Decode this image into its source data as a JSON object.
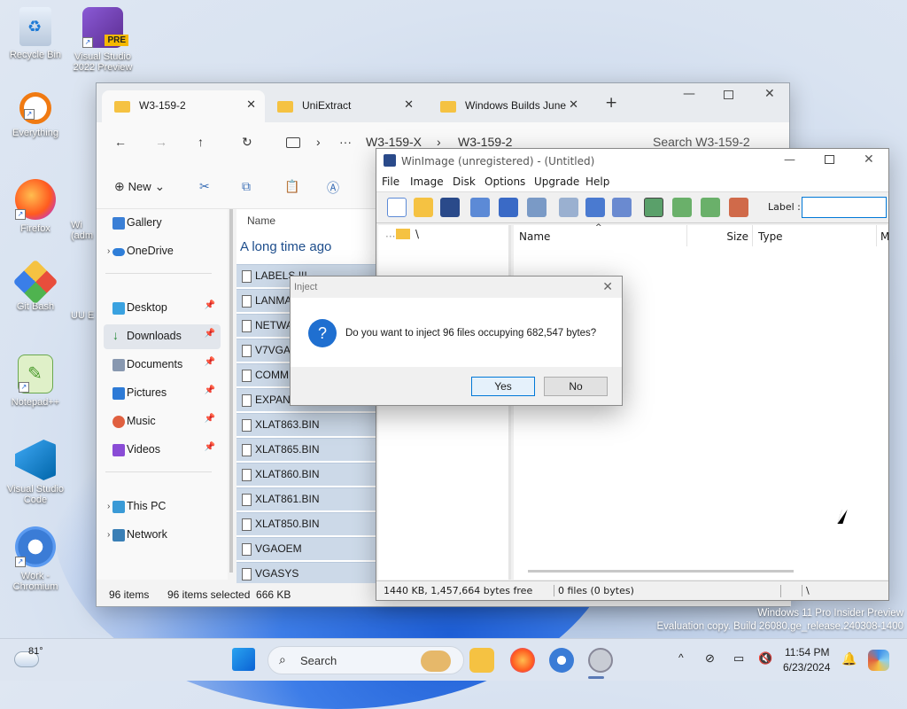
{
  "desktop": {
    "icons": [
      "Recycle Bin",
      "Visual Studio 2022 Preview",
      "Everything",
      "Firefox",
      "Git Bash",
      "Notepad++",
      "Visual Studio Code",
      "Work - Chromium"
    ],
    "partial_labels": [
      "Wi",
      "Wi (adm",
      "UU E"
    ],
    "pre_badge": "PRE"
  },
  "explorer": {
    "tabs": [
      "W3-159-2",
      "UniExtract",
      "Windows Builds June"
    ],
    "new_tab": "+",
    "breadcrumb": [
      "W3-159-X",
      "W3-159-2"
    ],
    "more": "···",
    "search_placeholder": "Search W3-159-2",
    "new_label": "New",
    "nav": [
      "Gallery",
      "OneDrive",
      "Desktop",
      "Downloads",
      "Documents",
      "Pictures",
      "Music",
      "Videos",
      "This PC",
      "Network"
    ],
    "col_name": "Name",
    "group": "A long time ago",
    "files": [
      "LABELS.!!!",
      "LANMA",
      "NETWA",
      "V7VGA.",
      "COMM",
      "EXPAND",
      "XLAT863.BIN",
      "XLAT865.BIN",
      "XLAT860.BIN",
      "XLAT861.BIN",
      "XLAT850.BIN",
      "VGAOEM",
      "VGASYS"
    ],
    "status_items": "96 items",
    "status_sel": "96 items selected  666 KB"
  },
  "winimage": {
    "title": "WinImage (unregistered) - (Untitled)",
    "menu": [
      "File",
      "Image",
      "Disk",
      "Options",
      "Upgrade",
      "Help"
    ],
    "label": "Label :",
    "tree_root": "\\",
    "cols": [
      "Name",
      "Size",
      "Type",
      "M"
    ],
    "status_left": "1440 KB, 1,457,664 bytes free",
    "status_mid": "0 files (0 bytes)",
    "status_right": "\\"
  },
  "dialog": {
    "title": "Inject",
    "message": "Do you want to inject 96 files occupying 682,547 bytes?",
    "yes": "Yes",
    "no": "No",
    "icon": "?"
  },
  "watermark": {
    "line1": "Windows 11 Pro Insider Preview",
    "line2": "Evaluation copy. Build 26080.ge_release.240308-1400"
  },
  "taskbar": {
    "weather": "81°",
    "search": "Search",
    "time": "11:54 PM",
    "date": "6/23/2024"
  },
  "colors": {
    "accent": "#0078d7",
    "folder": "#f5c242",
    "selection": "#ccd9e8"
  }
}
